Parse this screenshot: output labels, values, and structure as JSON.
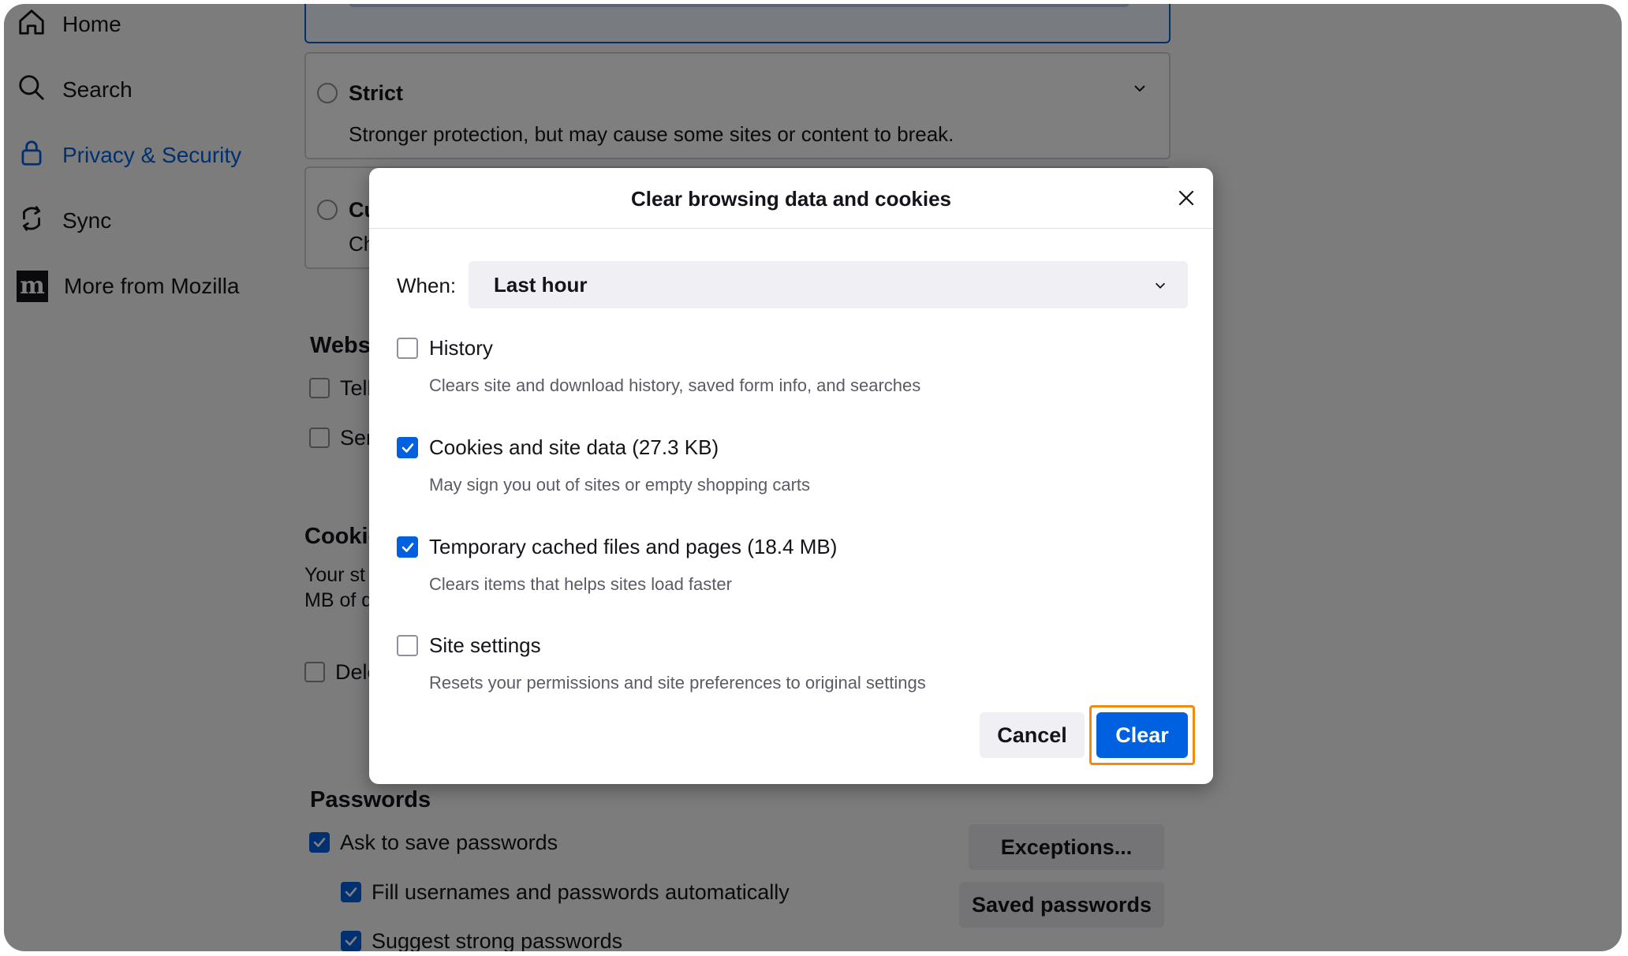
{
  "sidebar": {
    "items": [
      {
        "label": "Home",
        "icon": "home-icon"
      },
      {
        "label": "Search",
        "icon": "search-icon"
      },
      {
        "label": "Privacy & Security",
        "icon": "lock-icon",
        "active": true
      },
      {
        "label": "Sync",
        "icon": "sync-icon"
      },
      {
        "label": "More from Mozilla",
        "icon": "mozilla-icon",
        "logo_letter": "m"
      }
    ]
  },
  "tracking_protection": {
    "strict": {
      "title": "Strict",
      "description": "Stronger protection, but may cause some sites or content to break."
    },
    "custom": {
      "title_partial": "Cu",
      "description_partial": "Ch"
    }
  },
  "website_prefs": {
    "heading_partial": "Webs",
    "items": [
      {
        "label_partial": "Tell",
        "checked": false
      },
      {
        "label_partial": "Ser",
        "checked": false
      }
    ]
  },
  "cookies_section": {
    "heading_partial": "Cookie",
    "text_line1_partial": "Your st",
    "text_line2_partial": "MB of d",
    "delete_partial": "Dele"
  },
  "passwords": {
    "heading": "Passwords",
    "ask_to_save": "Ask to save passwords",
    "fill_auto": "Fill usernames and passwords automatically",
    "suggest_strong": "Suggest strong passwords",
    "exceptions_button": "Exceptions...",
    "saved_passwords_button": "Saved passwords"
  },
  "dialog": {
    "title": "Clear browsing data and cookies",
    "when_label": "When:",
    "when_value": "Last hour",
    "options": [
      {
        "label": "History",
        "description": "Clears site and download history, saved form info, and searches",
        "checked": false
      },
      {
        "label": "Cookies and site data (27.3 KB)",
        "description": "May sign you out of sites or empty shopping carts",
        "checked": true
      },
      {
        "label": "Temporary cached files and pages (18.4 MB)",
        "description": "Clears items that helps sites load faster",
        "checked": true
      },
      {
        "label": "Site settings",
        "description": "Resets your permissions and site preferences to original settings",
        "checked": false
      }
    ],
    "cancel_label": "Cancel",
    "clear_label": "Clear"
  },
  "colors": {
    "accent": "#0061e0",
    "highlight": "#f28b0c",
    "overlay": "rgba(0,0,0,0.5)"
  }
}
